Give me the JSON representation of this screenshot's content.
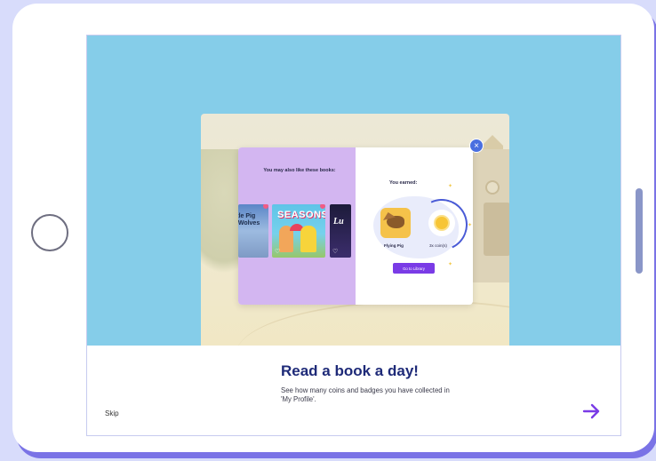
{
  "modal": {
    "left_title": "You may also like these books:",
    "right_title": "You earned:",
    "books": [
      {
        "title": "ittle Pig\ne Wolves"
      },
      {
        "title": "SEASONS"
      },
      {
        "title": "Lu"
      }
    ],
    "badge_label": "Flying Pig",
    "coin_label": "3x coin(s)",
    "library_button": "Go to Library",
    "close_icon": "×"
  },
  "onboarding": {
    "heading": "Read a book a day!",
    "description": "See how many coins and badges you have collected in 'My Profile'.",
    "skip_label": "Skip",
    "next_icon": "arrow-right-icon"
  },
  "colors": {
    "accent": "#7a3be6",
    "heading": "#1e2a78",
    "hero_bg": "#85cde9"
  }
}
